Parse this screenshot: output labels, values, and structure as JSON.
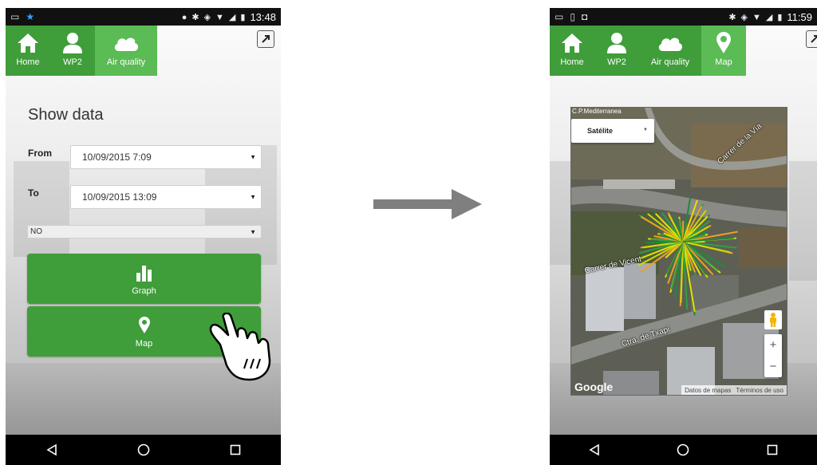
{
  "left_screen": {
    "status_bar": {
      "time": "13:48"
    },
    "nav": [
      {
        "label": "Home",
        "icon": "home-icon"
      },
      {
        "label": "WP2",
        "icon": "user-icon"
      },
      {
        "label": "Air quality",
        "icon": "cloud-icon"
      }
    ],
    "title": "Show data",
    "from_label": "From",
    "from_value": "10/09/2015 7:09",
    "to_label": "To",
    "to_value": "10/09/2015 13:09",
    "pollutant_value": "NO",
    "graph_button": "Graph",
    "map_button": "Map"
  },
  "right_screen": {
    "status_bar": {
      "time": "11:59"
    },
    "nav": [
      {
        "label": "Home",
        "icon": "home-icon"
      },
      {
        "label": "WP2",
        "icon": "user-icon"
      },
      {
        "label": "Air quality",
        "icon": "cloud-icon"
      },
      {
        "label": "Map",
        "icon": "map-pin-icon"
      }
    ],
    "map": {
      "map_type": "Satélite",
      "attribution_top": "C.P.Mediterranea",
      "street_1": "Carrer de la Vía",
      "street_2": "Carrer de Vicent",
      "street_3": "Ctra. de Txapi",
      "footer_data": "Datos de mapas",
      "footer_terms": "Términos de uso",
      "logo": "Google"
    }
  },
  "colors": {
    "nav_green": "#3f9d3a",
    "nav_active": "#5bbb55"
  }
}
